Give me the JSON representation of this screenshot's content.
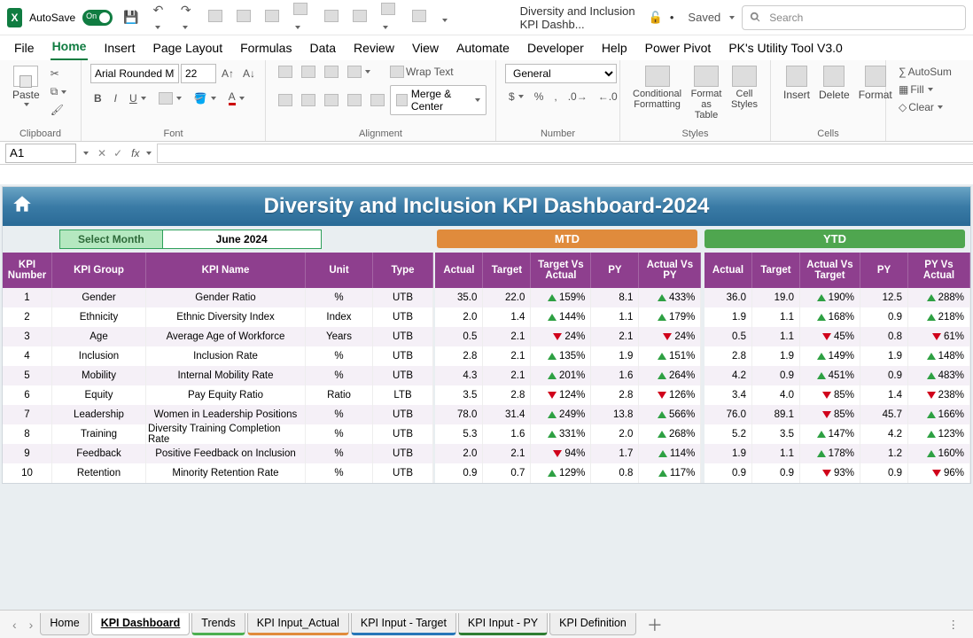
{
  "titlebar": {
    "autosave_label": "AutoSave",
    "autosave_on": "On",
    "filename": "Diversity and Inclusion KPI Dashb...",
    "saved_label": "Saved",
    "search_placeholder": "Search"
  },
  "ribbon_tabs": [
    "File",
    "Home",
    "Insert",
    "Page Layout",
    "Formulas",
    "Data",
    "Review",
    "View",
    "Automate",
    "Developer",
    "Help",
    "Power Pivot",
    "PK's Utility Tool V3.0"
  ],
  "ribbon_active_tab": "Home",
  "ribbon": {
    "clipboard_label": "Clipboard",
    "paste_label": "Paste",
    "font_label": "Font",
    "font_name": "Arial Rounded MT",
    "font_size": "22",
    "alignment_label": "Alignment",
    "wrap_text_label": "Wrap Text",
    "merge_center_label": "Merge & Center",
    "number_label": "Number",
    "number_format": "General",
    "styles_label": "Styles",
    "cond_fmt_label": "Conditional Formatting",
    "fmt_table_label": "Format as Table",
    "cell_styles_label": "Cell Styles",
    "cells_label": "Cells",
    "insert_label": "Insert",
    "delete_label": "Delete",
    "format_label": "Format",
    "autosum_label": "AutoSum",
    "fill_label": "Fill",
    "clear_label": "Clear"
  },
  "name_box": "A1",
  "dashboard": {
    "title": "Diversity and Inclusion KPI Dashboard-2024",
    "select_month_label": "Select Month",
    "selected_month": "June 2024",
    "mtd_label": "MTD",
    "ytd_label": "YTD",
    "left_headers": [
      "KPI Number",
      "KPI Group",
      "KPI Name",
      "Unit",
      "Type"
    ],
    "metric_headers": [
      "Actual",
      "Target",
      "Target Vs Actual",
      "PY",
      "Actual Vs PY"
    ],
    "ytd_headers": [
      "Actual",
      "Target",
      "Actual Vs Target",
      "PY",
      "PY Vs Actual"
    ],
    "rows": [
      {
        "num": "1",
        "group": "Gender",
        "name": "Gender Ratio",
        "unit": "%",
        "type": "UTB",
        "mtd": {
          "actual": "35.0",
          "target": "22.0",
          "tva_dir": "up",
          "tva": "159%",
          "py": "8.1",
          "avp_dir": "up",
          "avp": "433%"
        },
        "ytd": {
          "actual": "36.0",
          "target": "19.0",
          "avt_dir": "up",
          "avt": "190%",
          "py": "12.5",
          "pva_dir": "up",
          "pva": "288%"
        }
      },
      {
        "num": "2",
        "group": "Ethnicity",
        "name": "Ethnic Diversity Index",
        "unit": "Index",
        "type": "UTB",
        "mtd": {
          "actual": "2.0",
          "target": "1.4",
          "tva_dir": "up",
          "tva": "144%",
          "py": "1.1",
          "avp_dir": "up",
          "avp": "179%"
        },
        "ytd": {
          "actual": "1.9",
          "target": "1.1",
          "avt_dir": "up",
          "avt": "168%",
          "py": "0.9",
          "pva_dir": "up",
          "pva": "218%"
        }
      },
      {
        "num": "3",
        "group": "Age",
        "name": "Average Age of Workforce",
        "unit": "Years",
        "type": "UTB",
        "mtd": {
          "actual": "0.5",
          "target": "2.1",
          "tva_dir": "dn",
          "tva": "24%",
          "py": "2.1",
          "avp_dir": "dn",
          "avp": "24%"
        },
        "ytd": {
          "actual": "0.5",
          "target": "1.1",
          "avt_dir": "dn",
          "avt": "45%",
          "py": "0.8",
          "pva_dir": "dn",
          "pva": "61%"
        }
      },
      {
        "num": "4",
        "group": "Inclusion",
        "name": "Inclusion Rate",
        "unit": "%",
        "type": "UTB",
        "mtd": {
          "actual": "2.8",
          "target": "2.1",
          "tva_dir": "up",
          "tva": "135%",
          "py": "1.9",
          "avp_dir": "up",
          "avp": "151%"
        },
        "ytd": {
          "actual": "2.8",
          "target": "1.9",
          "avt_dir": "up",
          "avt": "149%",
          "py": "1.9",
          "pva_dir": "up",
          "pva": "148%"
        }
      },
      {
        "num": "5",
        "group": "Mobility",
        "name": "Internal Mobility Rate",
        "unit": "%",
        "type": "UTB",
        "mtd": {
          "actual": "4.3",
          "target": "2.1",
          "tva_dir": "up",
          "tva": "201%",
          "py": "1.6",
          "avp_dir": "up",
          "avp": "264%"
        },
        "ytd": {
          "actual": "4.2",
          "target": "0.9",
          "avt_dir": "up",
          "avt": "451%",
          "py": "0.9",
          "pva_dir": "up",
          "pva": "483%"
        }
      },
      {
        "num": "6",
        "group": "Equity",
        "name": "Pay Equity Ratio",
        "unit": "Ratio",
        "type": "LTB",
        "mtd": {
          "actual": "3.5",
          "target": "2.8",
          "tva_dir": "dn",
          "tva": "124%",
          "py": "2.8",
          "avp_dir": "dn",
          "avp": "126%"
        },
        "ytd": {
          "actual": "3.4",
          "target": "4.0",
          "avt_dir": "dn",
          "avt": "85%",
          "py": "1.4",
          "pva_dir": "dn",
          "pva": "238%"
        }
      },
      {
        "num": "7",
        "group": "Leadership",
        "name": "Women in Leadership Positions",
        "unit": "%",
        "type": "UTB",
        "mtd": {
          "actual": "78.0",
          "target": "31.4",
          "tva_dir": "up",
          "tva": "249%",
          "py": "13.8",
          "avp_dir": "up",
          "avp": "566%"
        },
        "ytd": {
          "actual": "76.0",
          "target": "89.1",
          "avt_dir": "dn",
          "avt": "85%",
          "py": "45.7",
          "pva_dir": "up",
          "pva": "166%"
        }
      },
      {
        "num": "8",
        "group": "Training",
        "name": "Diversity Training Completion Rate",
        "unit": "%",
        "type": "UTB",
        "mtd": {
          "actual": "5.3",
          "target": "1.6",
          "tva_dir": "up",
          "tva": "331%",
          "py": "2.0",
          "avp_dir": "up",
          "avp": "268%"
        },
        "ytd": {
          "actual": "5.2",
          "target": "3.5",
          "avt_dir": "up",
          "avt": "147%",
          "py": "4.2",
          "pva_dir": "up",
          "pva": "123%"
        }
      },
      {
        "num": "9",
        "group": "Feedback",
        "name": "Positive Feedback on Inclusion",
        "unit": "%",
        "type": "UTB",
        "mtd": {
          "actual": "2.0",
          "target": "2.1",
          "tva_dir": "dn",
          "tva": "94%",
          "py": "1.7",
          "avp_dir": "up",
          "avp": "114%"
        },
        "ytd": {
          "actual": "1.9",
          "target": "1.1",
          "avt_dir": "up",
          "avt": "178%",
          "py": "1.2",
          "pva_dir": "up",
          "pva": "160%"
        }
      },
      {
        "num": "10",
        "group": "Retention",
        "name": "Minority Retention Rate",
        "unit": "%",
        "type": "UTB",
        "mtd": {
          "actual": "0.9",
          "target": "0.7",
          "tva_dir": "up",
          "tva": "129%",
          "py": "0.8",
          "avp_dir": "up",
          "avp": "117%"
        },
        "ytd": {
          "actual": "0.9",
          "target": "0.9",
          "avt_dir": "dn",
          "avt": "93%",
          "py": "0.9",
          "pva_dir": "dn",
          "pva": "96%"
        }
      }
    ]
  },
  "sheet_tabs": [
    {
      "label": "Home",
      "cls": ""
    },
    {
      "label": "KPI Dashboard",
      "cls": "active"
    },
    {
      "label": "Trends",
      "cls": "green"
    },
    {
      "label": "KPI Input_Actual",
      "cls": "orange"
    },
    {
      "label": "KPI Input - Target",
      "cls": "blue"
    },
    {
      "label": "KPI Input - PY",
      "cls": "dgreen"
    },
    {
      "label": "KPI Definition",
      "cls": ""
    }
  ]
}
